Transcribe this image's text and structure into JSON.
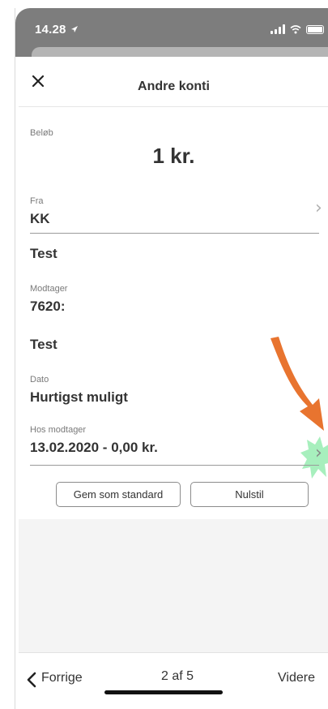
{
  "status_bar": {
    "time": "14.28",
    "icons": [
      "location-arrow-icon",
      "cellular-signal-icon",
      "wifi-icon",
      "battery-icon"
    ]
  },
  "header": {
    "title": "Andre konti",
    "close_icon": "close-icon"
  },
  "fields": {
    "amount_label": "Beløb",
    "amount_value": "1 kr.",
    "from_label": "Fra",
    "from_value": "KK",
    "from_text": "Test",
    "recipient_label": "Modtager",
    "recipient_value": "7620:",
    "recipient_text": "Test",
    "date_label": "Dato",
    "date_value": "Hurtigst muligt",
    "at_recipient_label": "Hos modtager",
    "at_recipient_value": "13.02.2020 - 0,00 kr."
  },
  "buttons": {
    "save_default": "Gem som standard",
    "reset": "Nulstil"
  },
  "bottom_nav": {
    "previous": "Forrige",
    "page_indicator": "2 af 5",
    "next": "Videre"
  },
  "colors": {
    "status_bar": "#7d7d7d",
    "annotation_arrow": "#e8742f",
    "annotation_starburst": "#a7efbd",
    "text": "#333333"
  }
}
